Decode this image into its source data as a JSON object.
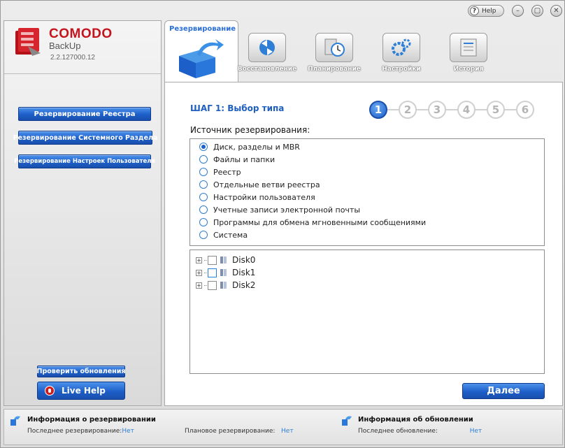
{
  "window": {
    "help_label": "Help",
    "help_glyph": "?",
    "minimize_glyph": "–",
    "maximize_glyph": "▢",
    "close_glyph": "✕"
  },
  "brand": {
    "name": "COMODO",
    "product": "BackUp",
    "version": "2.2.127000.12",
    "accent": "#c4141e"
  },
  "sidebar": {
    "actions": [
      {
        "label": "Резервирование Реестра"
      },
      {
        "label": "Резервирование Системного Раздела"
      },
      {
        "label": "Резервирование Настроек Пользователя"
      }
    ],
    "check_updates": "Проверить обновления",
    "live_help": "Live Help"
  },
  "tabs": {
    "active": {
      "label": "Резервирование",
      "icon": "backup-box-icon"
    },
    "items": [
      {
        "label": "Восстановление",
        "icon": "restore-icon"
      },
      {
        "label": "Планирование",
        "icon": "schedule-icon"
      },
      {
        "label": "Настройки",
        "icon": "settings-icon"
      },
      {
        "label": "История",
        "icon": "history-icon"
      }
    ]
  },
  "main": {
    "step_title": "ШАГ 1: Выбор типа",
    "steps": [
      "1",
      "2",
      "3",
      "4",
      "5",
      "6"
    ],
    "current_step": 1,
    "source_label": "Источник резервирования:",
    "sources": [
      {
        "label": "Диск, разделы и MBR",
        "selected": true
      },
      {
        "label": "Файлы и папки",
        "selected": false
      },
      {
        "label": "Реестр",
        "selected": false
      },
      {
        "label": "Отдельные ветви реестра",
        "selected": false
      },
      {
        "label": "Настройки пользователя",
        "selected": false
      },
      {
        "label": "Учетные записи электронной почты",
        "selected": false
      },
      {
        "label": "Программы для обмена мгновенными сообщениями",
        "selected": false
      },
      {
        "label": "Система",
        "selected": false
      }
    ],
    "disks": [
      {
        "label": "Disk0"
      },
      {
        "label": "Disk1"
      },
      {
        "label": "Disk2"
      }
    ],
    "next_label": "Далее",
    "accent": "#1e5fc8"
  },
  "footer": {
    "backup_info": {
      "title": "Информация о резервировании",
      "last_label": "Последнее резервирование:",
      "last_value": "Нет",
      "scheduled_label": "Плановое резервирование:",
      "scheduled_value": "Нет"
    },
    "update_info": {
      "title": "Информация об обновлении",
      "last_label": "Последнее обновление:",
      "last_value": "Нет"
    }
  }
}
